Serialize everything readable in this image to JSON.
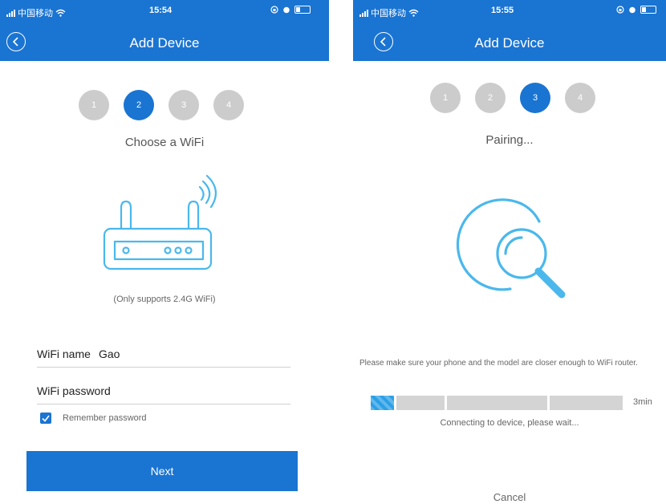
{
  "screen_left": {
    "status": {
      "carrier": "中国移动",
      "time": "15:54"
    },
    "header": {
      "title": "Add Device"
    },
    "steps": [
      {
        "label": "1",
        "state": "inactive"
      },
      {
        "label": "2",
        "state": "active"
      },
      {
        "label": "3",
        "state": "inactive"
      },
      {
        "label": "4",
        "state": "inactive"
      }
    ],
    "subtitle": "Choose a WiFi",
    "illustration": "router-icon",
    "note": "(Only supports 2.4G WiFi)",
    "wifi_name": {
      "label": "WiFi name",
      "value": "Gao"
    },
    "wifi_password": {
      "label": "WiFi password",
      "value": ""
    },
    "remember": {
      "label": "Remember password",
      "checked": true
    },
    "next_button": "Next"
  },
  "screen_right": {
    "status": {
      "carrier": "中国移动",
      "time": "15:55"
    },
    "header": {
      "title": "Add Device"
    },
    "steps": [
      {
        "label": "1",
        "state": "inactive"
      },
      {
        "label": "2",
        "state": "inactive"
      },
      {
        "label": "3",
        "state": "active"
      },
      {
        "label": "4",
        "state": "inactive"
      }
    ],
    "subtitle": "Pairing...",
    "illustration": "search-magnifier-icon",
    "tip": "Please make sure your phone and the model are closer enough to WiFi router.",
    "progress": {
      "fraction": 0.09,
      "time_label": "3min"
    },
    "connecting_text": "Connecting to device, please wait...",
    "cancel": "Cancel"
  },
  "colors": {
    "accent": "#1a74d2",
    "inactive_step": "#cccccc",
    "illustration": "#4ab8ec"
  }
}
